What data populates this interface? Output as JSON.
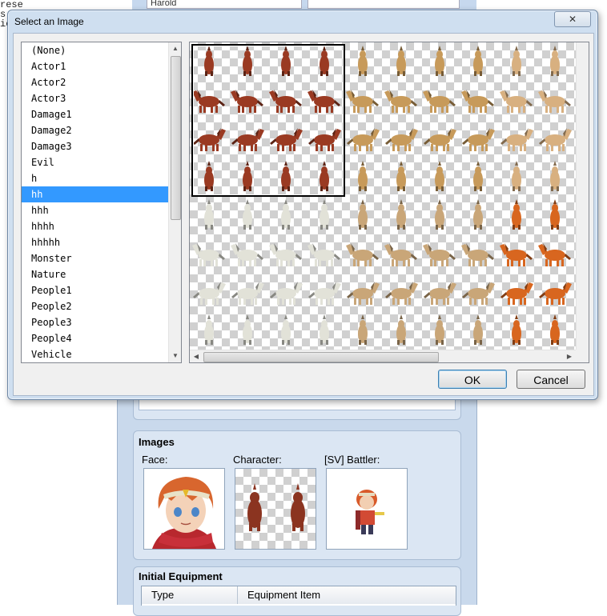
{
  "background": {
    "left_text": [
      "rese",
      "s",
      "ic"
    ],
    "top_field_text": "Harold",
    "images_group": {
      "title": "Images",
      "face_label": "Face:",
      "character_label": "Character:",
      "battler_label": "[SV] Battler:"
    },
    "equipment_group": {
      "title": "Initial Equipment",
      "columns": [
        "Type",
        "Equipment Item"
      ]
    }
  },
  "dialog": {
    "title": "Select an Image",
    "close_glyph": "✕",
    "list": {
      "items": [
        "(None)",
        "Actor1",
        "Actor2",
        "Actor3",
        "Damage1",
        "Damage2",
        "Damage3",
        "Evil",
        "h",
        "hh",
        "hhh",
        "hhhh",
        "hhhhh",
        "Monster",
        "Nature",
        "People1",
        "People2",
        "People3",
        "People4",
        "Vehicle"
      ],
      "selected_index": 9
    },
    "ok_label": "OK",
    "cancel_label": "Cancel"
  },
  "colors": {
    "selection": "#3399ff",
    "dialog_frame": "#cfdff0",
    "horse_palettes": [
      "#9a3a22",
      "#c79a5a",
      "#d8b080",
      "#e2e2d8",
      "#c9a678",
      "#d8661f"
    ]
  },
  "icons": {
    "close": "close-icon",
    "scroll_up": "arrow-up-icon",
    "scroll_down": "arrow-down-icon",
    "scroll_left": "arrow-left-icon",
    "scroll_right": "arrow-right-icon"
  }
}
